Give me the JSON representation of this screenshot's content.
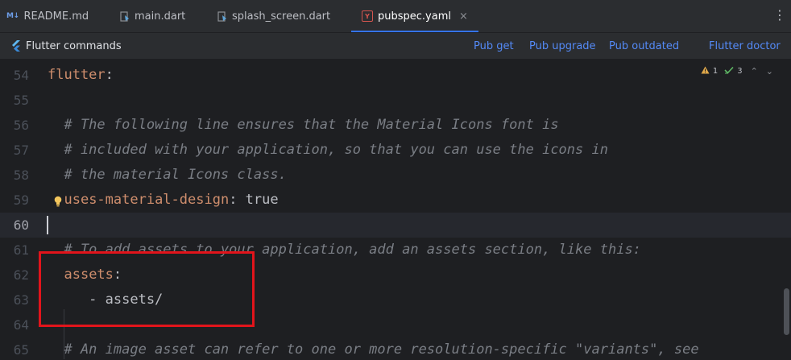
{
  "tabs": [
    {
      "label": "README.md",
      "icon": "markdown-icon",
      "icon_text": "M↓",
      "active": false
    },
    {
      "label": "main.dart",
      "icon": "dart-file-icon",
      "active": false
    },
    {
      "label": "splash_screen.dart",
      "icon": "dart-file-icon",
      "active": false
    },
    {
      "label": "pubspec.yaml",
      "icon": "yaml-file-icon",
      "icon_text": "Y",
      "active": true
    }
  ],
  "tab_close_glyph": "×",
  "more_glyph": "⋮",
  "flutter_bar": {
    "title": "Flutter commands",
    "actions": [
      "Pub get",
      "Pub upgrade",
      "Pub outdated",
      "Flutter doctor"
    ]
  },
  "inspections": {
    "warnings": "1",
    "weak_warnings": "3",
    "up_glyph": "⌃",
    "down_glyph": "⌄"
  },
  "editor": {
    "lines": [
      {
        "num": "54",
        "key": "flutter",
        "colon": ":"
      },
      {
        "num": "55"
      },
      {
        "num": "56",
        "comment": "  # The following line ensures that the Material Icons font is"
      },
      {
        "num": "57",
        "comment": "  # included with your application, so that you can use the icons in"
      },
      {
        "num": "58",
        "comment": "  # the material Icons class."
      },
      {
        "num": "59",
        "indent": "  ",
        "key": "uses-material-design",
        "colon": ": ",
        "value": "true"
      },
      {
        "num": "60"
      },
      {
        "num": "61",
        "comment": "  # To add assets to your application, add an assets section, like this:"
      },
      {
        "num": "62",
        "indent": "  ",
        "key": "assets",
        "colon": ":"
      },
      {
        "num": "63",
        "value": "     - assets/"
      },
      {
        "num": "64"
      },
      {
        "num": "65",
        "comment": "  # An image asset can refer to one or more resolution-specific \"variants\", see"
      }
    ],
    "current_line": "60"
  },
  "colors": {
    "accent": "#3574f0",
    "link": "#548af7",
    "key": "#cf8e6d",
    "comment": "#7a7e85",
    "annotation": "#e2141b"
  }
}
